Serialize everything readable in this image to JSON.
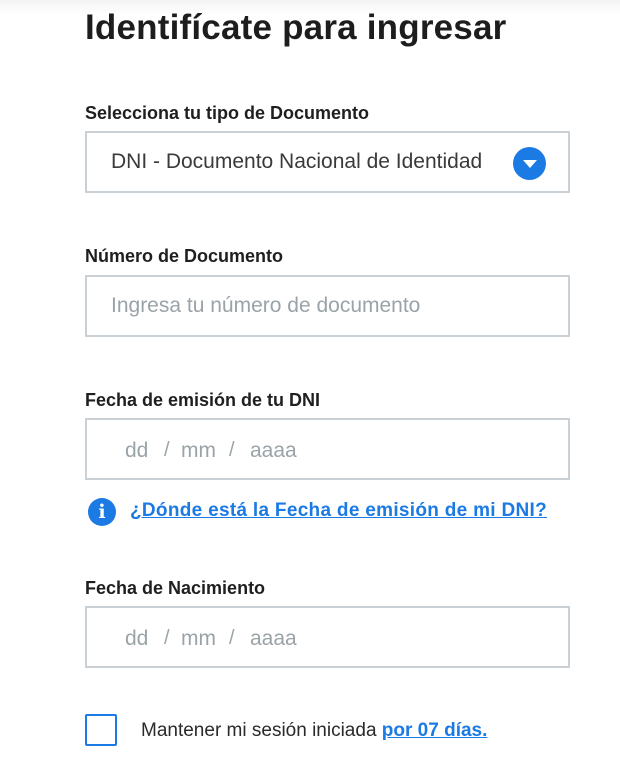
{
  "page": {
    "title": "Identifícate para ingresar"
  },
  "document_type": {
    "label": "Selecciona tu tipo de Documento",
    "selected_value": "DNI - Documento Nacional de Identidad",
    "icon": "chevron-down-icon"
  },
  "document_number": {
    "label": "Número de Documento",
    "value": "",
    "placeholder": "Ingresa tu número de documento"
  },
  "issue_date": {
    "label": "Fecha de emisión de tu DNI",
    "day_placeholder": "dd",
    "month_placeholder": "mm",
    "year_placeholder": "aaaa",
    "separator": "/",
    "help_icon": "info-icon",
    "help_icon_glyph": "i",
    "help_link": "¿Dónde está la Fecha de emisión de mi DNI?"
  },
  "birth_date": {
    "label": "Fecha de Nacimiento",
    "day_placeholder": "dd",
    "month_placeholder": "mm",
    "year_placeholder": "aaaa",
    "separator": "/"
  },
  "remember_session": {
    "checked": false,
    "text": "Mantener mi sesión iniciada ",
    "link": "por 07 días."
  },
  "colors": {
    "accent": "#1b7ae4",
    "border": "#c9d1d6",
    "placeholder": "#9aa3a8",
    "text": "#1d1d1d"
  }
}
